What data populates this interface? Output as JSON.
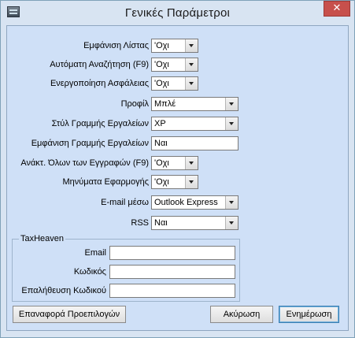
{
  "window": {
    "title": "Γενικές Παράμετροι",
    "close_glyph": "✕"
  },
  "fields": {
    "show_list": {
      "label": "Εμφάνιση Λίστας",
      "value": "'Οχι"
    },
    "auto_search": {
      "label": "Αυτόματη Αναζήτηση (F9)",
      "value": "'Οχι"
    },
    "security": {
      "label": "Ενεργοποίηση Ασφάλειας",
      "value": "'Οχι"
    },
    "profile": {
      "label": "Προφίλ",
      "value": "Μπλέ"
    },
    "toolbar_style": {
      "label": "Στύλ Γραμμής Εργαλείων",
      "value": "XP"
    },
    "show_toolbar": {
      "label": "Εμφάνιση Γραμμής Εργαλείων",
      "value": "Ναι"
    },
    "retrieve_all": {
      "label": "Ανάκτ. Όλων των Εγγραφών (F9)",
      "value": "'Οχι"
    },
    "app_messages": {
      "label": "Μηνύματα Εφαρμογής",
      "value": "'Οχι"
    },
    "email_via": {
      "label": "E-mail μέσω",
      "value": "Outlook Express"
    },
    "rss": {
      "label": "RSS",
      "value": "Ναι"
    }
  },
  "taxheaven": {
    "group_label": "TaxHeaven",
    "email_label": "Email",
    "email_value": "",
    "password_label": "Κωδικός",
    "password_value": "",
    "confirm_label": "Επαλήθευση Κωδικού",
    "confirm_value": ""
  },
  "buttons": {
    "reset": "Επαναφορά Προεπιλογών",
    "cancel": "Ακύρωση",
    "update": "Ενημέρωση"
  }
}
